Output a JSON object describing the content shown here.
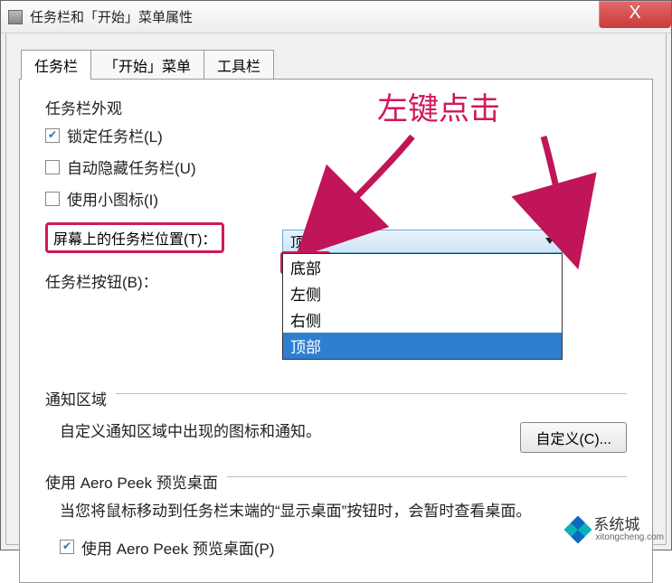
{
  "window": {
    "title": "任务栏和「开始」菜单属性",
    "close": "X"
  },
  "tabs": {
    "t0": "任务栏",
    "t1": "「开始」菜单",
    "t2": "工具栏"
  },
  "appearance": {
    "legend": "任务栏外观",
    "lock": "锁定任务栏(L)",
    "autohide": "自动隐藏任务栏(U)",
    "smallicons": "使用小图标(I)",
    "position_label": "屏幕上的任务栏位置(T)：",
    "position_value": "顶部",
    "buttons_label": "任务栏按钮(B)："
  },
  "dropdown": {
    "opt0": "底部",
    "opt1": "左侧",
    "opt2": "右侧",
    "opt3": "顶部"
  },
  "notify": {
    "legend": "通知区域",
    "desc": "自定义通知区域中出现的图标和通知。",
    "btn": "自定义(C)..."
  },
  "aero": {
    "legend": "使用 Aero Peek 预览桌面",
    "desc": "当您将鼠标移动到任务栏末端的“显示桌面”按钮时，会暂时查看桌面。",
    "cb": "使用 Aero Peek 预览桌面(P)"
  },
  "annotation": {
    "text": "左键点击"
  },
  "watermark": {
    "name": "系统城",
    "url": "xitongcheng.com"
  }
}
